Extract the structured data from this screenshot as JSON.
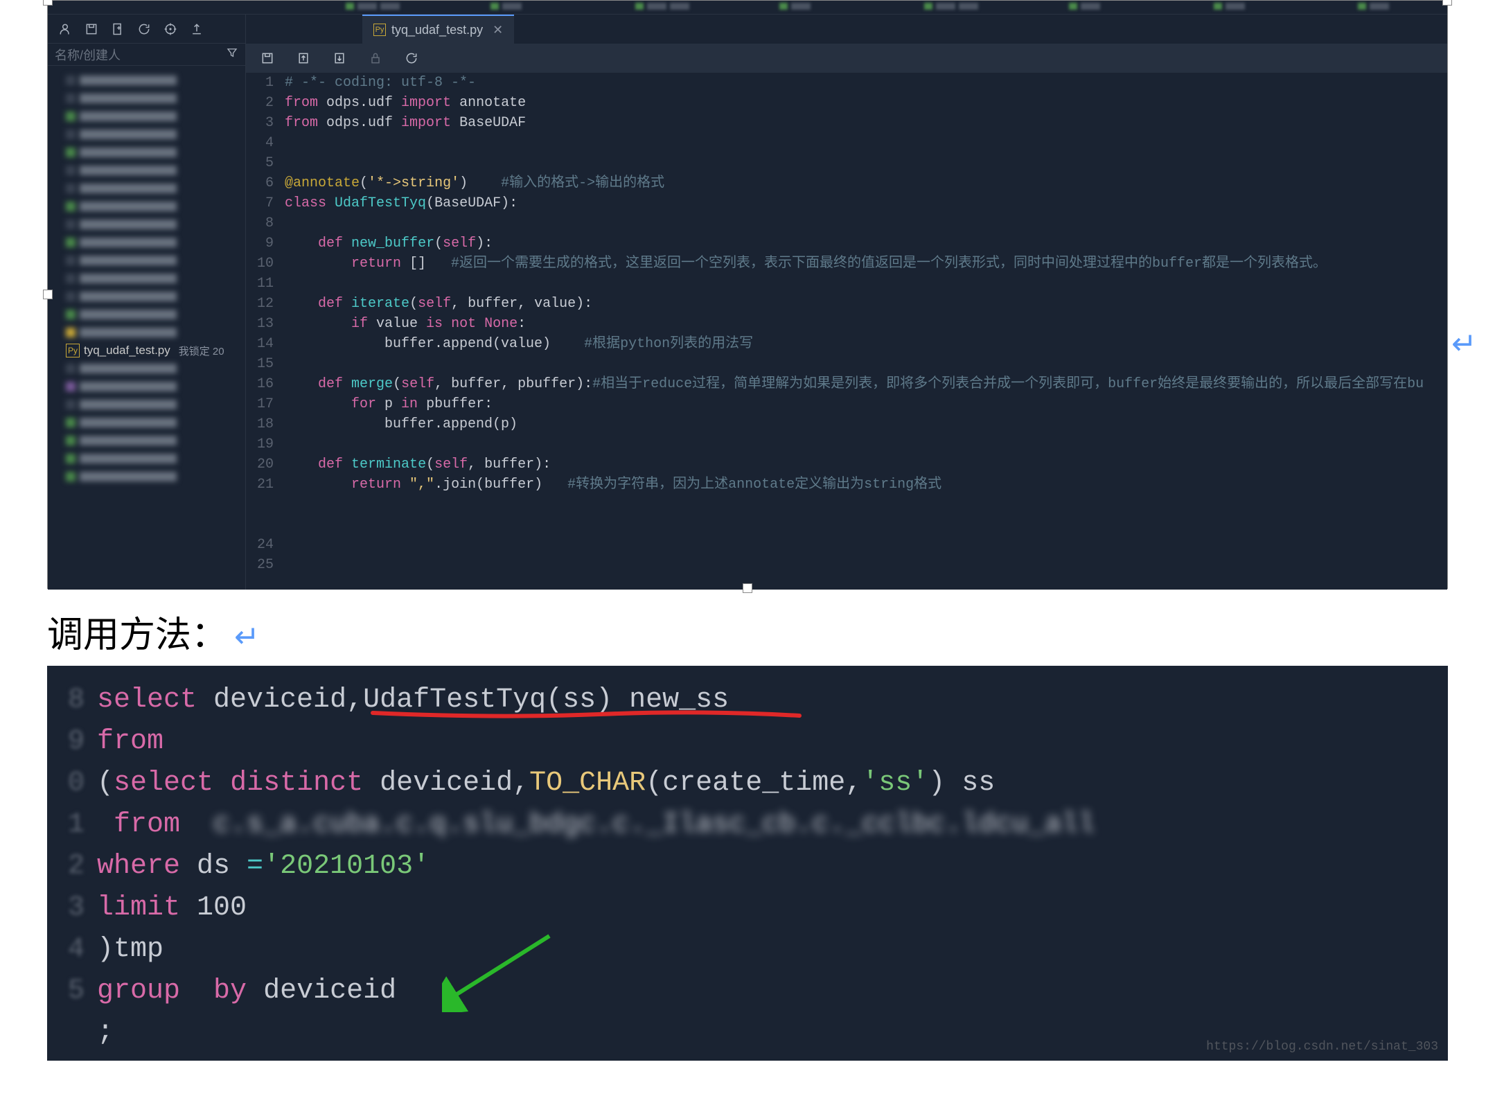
{
  "top_tab": {
    "icon_label": "Py",
    "filename": "tyq_udaf_test.py"
  },
  "sidebar": {
    "search_placeholder": "名称/创建人",
    "selected_file": {
      "icon_label": "Py",
      "name": "tyq_udaf_test.py",
      "lock_text": "我锁定  20"
    }
  },
  "editor": {
    "line_numbers": [
      "1",
      "2",
      "3",
      "4",
      "5",
      "6",
      "7",
      "8",
      "9",
      "10",
      "11",
      "12",
      "13",
      "14",
      "15",
      "16",
      "17",
      "18",
      "19",
      "20",
      "21",
      "",
      "",
      "24",
      "25",
      ""
    ],
    "code_tokens": [
      [
        [
          "c-cmt",
          "# -*- coding: utf-8 -*-"
        ]
      ],
      [
        [
          "c-kw",
          "from"
        ],
        [
          "c-var",
          " odps.udf "
        ],
        [
          "c-kw",
          "import"
        ],
        [
          "c-var",
          " annotate"
        ]
      ],
      [
        [
          "c-kw",
          "from"
        ],
        [
          "c-var",
          " odps.udf "
        ],
        [
          "c-kw",
          "import"
        ],
        [
          "c-var",
          " BaseUDAF"
        ]
      ],
      [
        [
          "",
          ""
        ]
      ],
      [
        [
          "",
          ""
        ]
      ],
      [
        [
          "c-dec",
          "@annotate"
        ],
        [
          "c-var",
          "("
        ],
        [
          "c-str",
          "'*->string'"
        ],
        [
          "c-var",
          ")    "
        ],
        [
          "c-cmt",
          "#输入的格式->输出的格式"
        ]
      ],
      [
        [
          "c-kw",
          "class"
        ],
        [
          "c-var",
          " "
        ],
        [
          "c-fn",
          "UdafTestTyq"
        ],
        [
          "c-var",
          "(BaseUDAF):"
        ]
      ],
      [
        [
          "",
          ""
        ]
      ],
      [
        [
          "c-var",
          "    "
        ],
        [
          "c-kw",
          "def"
        ],
        [
          "c-var",
          " "
        ],
        [
          "c-fn",
          "new_buffer"
        ],
        [
          "c-var",
          "("
        ],
        [
          "c-self",
          "self"
        ],
        [
          "c-var",
          "):"
        ]
      ],
      [
        [
          "c-var",
          "        "
        ],
        [
          "c-kw",
          "return"
        ],
        [
          "c-var",
          " []   "
        ],
        [
          "c-cmt",
          "#返回一个需要生成的格式，这里返回一个空列表，表示下面最终的值返回是一个列表形式，同时中间处理过程中的buffer都是一个列表格式。"
        ]
      ],
      [
        [
          "",
          ""
        ]
      ],
      [
        [
          "c-var",
          "    "
        ],
        [
          "c-kw",
          "def"
        ],
        [
          "c-var",
          " "
        ],
        [
          "c-fn",
          "iterate"
        ],
        [
          "c-var",
          "("
        ],
        [
          "c-self",
          "self"
        ],
        [
          "c-var",
          ", buffer, value):"
        ]
      ],
      [
        [
          "c-var",
          "        "
        ],
        [
          "c-kw",
          "if"
        ],
        [
          "c-var",
          " value "
        ],
        [
          "c-kw",
          "is"
        ],
        [
          "c-var",
          " "
        ],
        [
          "c-kw",
          "not"
        ],
        [
          "c-var",
          " "
        ],
        [
          "c-bi",
          "None"
        ],
        [
          "c-var",
          ":"
        ]
      ],
      [
        [
          "c-var",
          "            buffer.append(value)    "
        ],
        [
          "c-cmt",
          "#根据python列表的用法写"
        ]
      ],
      [
        [
          "",
          ""
        ]
      ],
      [
        [
          "c-var",
          "    "
        ],
        [
          "c-kw",
          "def"
        ],
        [
          "c-var",
          " "
        ],
        [
          "c-fn",
          "merge"
        ],
        [
          "c-var",
          "("
        ],
        [
          "c-self",
          "self"
        ],
        [
          "c-var",
          ", buffer, pbuffer):"
        ],
        [
          "c-cmt",
          "#相当于reduce过程，简单理解为如果是列表，即将多个列表合并成一个列表即可，buffer始终是最终要输出的，所以最后全部写在bu"
        ]
      ],
      [
        [
          "c-var",
          "        "
        ],
        [
          "c-kw",
          "for"
        ],
        [
          "c-var",
          " p "
        ],
        [
          "c-kw",
          "in"
        ],
        [
          "c-var",
          " pbuffer:"
        ]
      ],
      [
        [
          "c-var",
          "            buffer.append(p)"
        ]
      ],
      [
        [
          "",
          ""
        ]
      ],
      [
        [
          "c-var",
          "    "
        ],
        [
          "c-kw",
          "def"
        ],
        [
          "c-var",
          " "
        ],
        [
          "c-fn",
          "terminate"
        ],
        [
          "c-var",
          "("
        ],
        [
          "c-self",
          "self"
        ],
        [
          "c-var",
          ", buffer):"
        ]
      ],
      [
        [
          "c-var",
          "        "
        ],
        [
          "c-kw",
          "return"
        ],
        [
          "c-var",
          " "
        ],
        [
          "c-str",
          "\",\""
        ],
        [
          "c-var",
          ".join(buffer)   "
        ],
        [
          "c-cmt",
          "#转换为字符串，因为上述annotate定义输出为string格式"
        ]
      ],
      [
        [
          "",
          ""
        ]
      ],
      [
        [
          "",
          ""
        ]
      ],
      [
        [
          "",
          ""
        ]
      ],
      [
        [
          "",
          ""
        ]
      ],
      [
        [
          "",
          ""
        ]
      ]
    ]
  },
  "section_title": "调用方法：",
  "sql": {
    "line_numbers": [
      "8",
      "9",
      "0",
      "1",
      "2",
      "3",
      "4",
      "5",
      ""
    ],
    "code_tokens": [
      [
        [
          "s-kw",
          "select"
        ],
        [
          "s-pn",
          " deviceid,UdafTestTyq(ss) new_ss"
        ]
      ],
      [
        [
          "s-kw",
          "from"
        ]
      ],
      [
        [
          "s-pn",
          "("
        ],
        [
          "s-kw",
          "select"
        ],
        [
          "s-pn",
          " "
        ],
        [
          "s-kw",
          "distinct"
        ],
        [
          "s-pn",
          " deviceid,"
        ],
        [
          "s-fn",
          "TO_CHAR"
        ],
        [
          "s-pn",
          "(create_time,"
        ],
        [
          "s-str",
          "'ss'"
        ],
        [
          "s-pn",
          ") ss"
        ]
      ],
      [
        [
          "s-pn",
          " "
        ],
        [
          "s-kw",
          "from"
        ],
        [
          "s-pn",
          "  "
        ],
        [
          "blurred",
          "c.s_a.cuba.c.q.slu_bdgc.c._Ilasc_cb.c._cclbc.ldcu_all"
        ]
      ],
      [
        [
          "s-kw",
          "where"
        ],
        [
          "s-pn",
          " ds "
        ],
        [
          "s-op",
          "="
        ],
        [
          "s-str",
          "'20210103'"
        ]
      ],
      [
        [
          "s-kw",
          "limit"
        ],
        [
          "s-pn",
          " 100"
        ]
      ],
      [
        [
          "s-pn",
          ")tmp"
        ]
      ],
      [
        [
          "s-kw",
          "group"
        ],
        [
          "s-pn",
          "  "
        ],
        [
          "s-kw",
          "by"
        ],
        [
          "s-pn",
          " deviceid"
        ]
      ],
      [
        [
          "s-pn",
          ";"
        ]
      ]
    ]
  },
  "watermark": "https://blog.csdn.net/sinat_303"
}
